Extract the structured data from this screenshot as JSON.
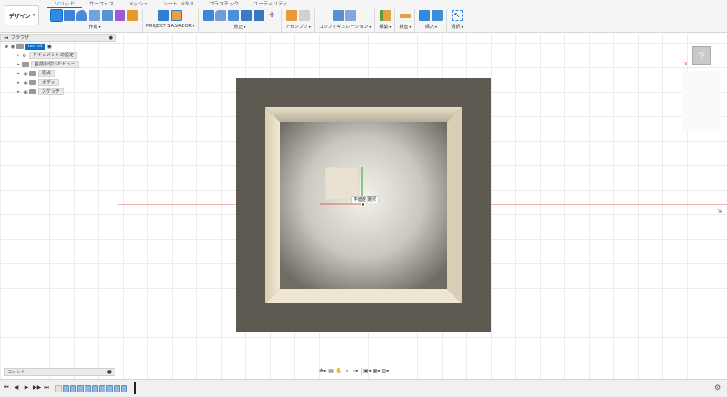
{
  "workspace": {
    "label": "デザイン",
    "caret": "▾"
  },
  "tabs": [
    {
      "label": "ソリッド",
      "active": true
    },
    {
      "label": "サーフェス",
      "active": false
    },
    {
      "label": "メッシュ",
      "active": false
    },
    {
      "label": "シート メタル",
      "active": false
    },
    {
      "label": "プラスチック",
      "active": false
    },
    {
      "label": "ユーティリティ",
      "active": false
    }
  ],
  "ribbon_groups": {
    "create": {
      "label": "作成",
      "caret": "▾"
    },
    "project": {
      "label": "PROJECT SALVADOR",
      "caret": "▾"
    },
    "modify": {
      "label": "修正",
      "caret": "▾"
    },
    "assemble": {
      "label": "アセンブリ",
      "caret": "▾"
    },
    "configure": {
      "label": "コンフィギュレーション",
      "caret": "▾"
    },
    "construct": {
      "label": "構築",
      "caret": "▾"
    },
    "inspect": {
      "label": "検査",
      "caret": "▾"
    },
    "insert": {
      "label": "挿入",
      "caret": "▾"
    },
    "select": {
      "label": "選択",
      "caret": "▾"
    }
  },
  "browser": {
    "title": "ブラウザ",
    "items": [
      {
        "label": "test v1",
        "level": 0
      },
      {
        "label": "ドキュメントの設定",
        "level": 1
      },
      {
        "label": "名前の付いたビュー",
        "level": 1
      },
      {
        "label": "原点",
        "level": 1
      },
      {
        "label": "ボディ",
        "level": 1
      },
      {
        "label": "スケッチ",
        "level": 1
      }
    ]
  },
  "comment": {
    "label": "コメント"
  },
  "canvas": {
    "tooltip": "平面を選択"
  },
  "viewcube": {
    "face": "下",
    "axis": "X"
  },
  "colors": {
    "accent": "#0a6ed1",
    "frame": "#5e5a51",
    "box_highlight": "#e9e2d3",
    "axis_x": "#f0b4b4",
    "axis_y": "#b5d9b5"
  }
}
